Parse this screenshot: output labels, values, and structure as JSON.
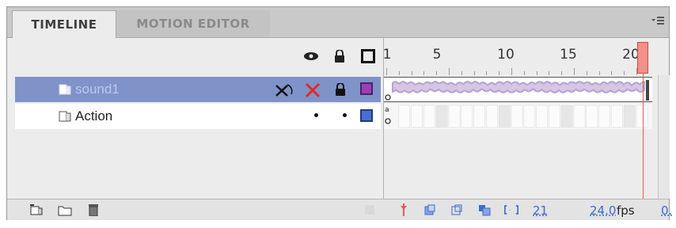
{
  "tabs": [
    {
      "label": "TIMELINE",
      "active": true
    },
    {
      "label": "MOTION EDITOR",
      "active": false
    }
  ],
  "header_icons": [
    "eye-icon",
    "lock-icon",
    "outline-icon"
  ],
  "ruler": {
    "labels": [
      "1",
      "5",
      "10",
      "15",
      "20"
    ]
  },
  "layers": [
    {
      "name": "sound1",
      "selected": true,
      "outline_color": "#9a3fb8",
      "has_sound": true
    },
    {
      "name": "Action",
      "selected": false,
      "outline_color": "#4a6fd1",
      "has_actions": true
    }
  ],
  "bottom": {
    "current_frame": "21",
    "frame_rate": "24.0",
    "fps_unit": "fps",
    "elapsed": "0."
  },
  "colors": {
    "selection": "#7f93c8",
    "playhead": "#e55a52",
    "link": "#3d6ad0"
  }
}
